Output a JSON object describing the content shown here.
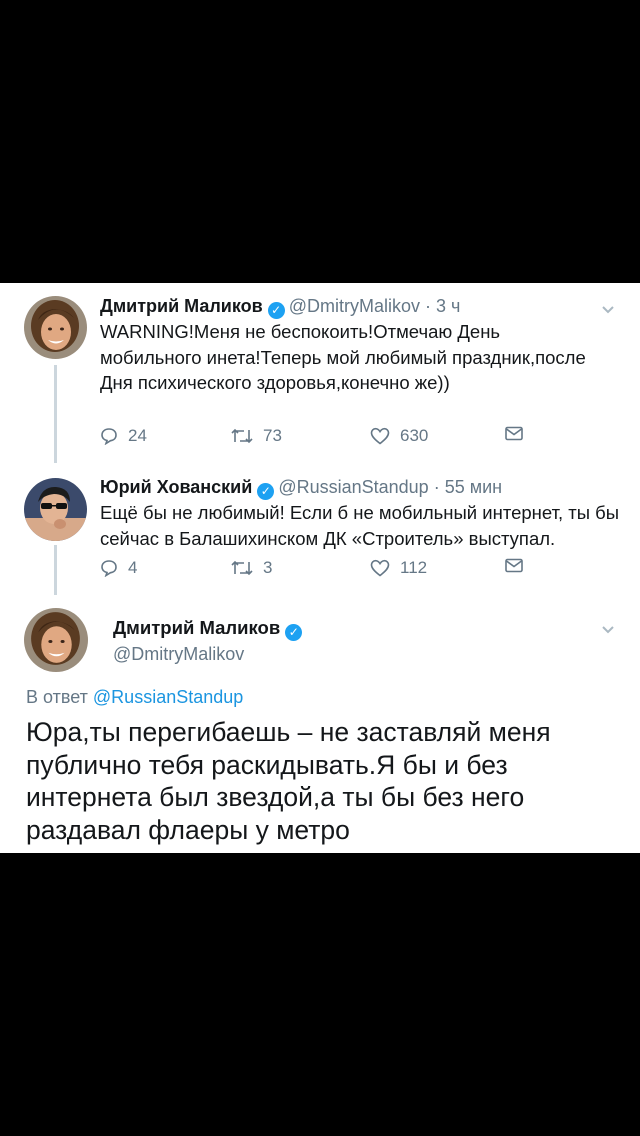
{
  "tweets": [
    {
      "author_name": "Дмитрий Маликов",
      "handle": "@DmitryMalikov",
      "time": "3 ч",
      "text": "WARNING!Меня не беспокоить!Отмечаю День мобильного инета!Теперь мой любимый праздник,после Дня психического здоровья,конечно же))",
      "replies": "24",
      "retweets": "73",
      "likes": "630"
    },
    {
      "author_name": "Юрий Хованский",
      "handle": "@RussianStandup",
      "time": "55 мин",
      "text": "Ещё бы не любимый! Если б не мобильный интернет, ты бы сейчас в Балашихинском ДК «Строитель» выступал.",
      "replies": "4",
      "retweets": "3",
      "likes": "112"
    }
  ],
  "main_tweet": {
    "author_name": "Дмитрий Маликов",
    "handle": "@DmitryMalikov",
    "reply_prefix": "В ответ",
    "reply_mention": "@RussianStandup",
    "text": "Юра,ты перегибаешь – не заставляй меня публично тебя раскидывать.Я бы и без интернета был звездой,а ты бы без него раздавал флаеры у метро"
  },
  "separator": "·",
  "colors": {
    "verified_badge": "#1da1f2",
    "mention": "#1b95e0",
    "secondary_text": "#657786",
    "thread_line": "#ccd6dd"
  },
  "icons": [
    "verified-badge-icon",
    "reply-icon",
    "retweet-icon",
    "like-icon",
    "direct-message-icon",
    "chevron-down-icon"
  ]
}
